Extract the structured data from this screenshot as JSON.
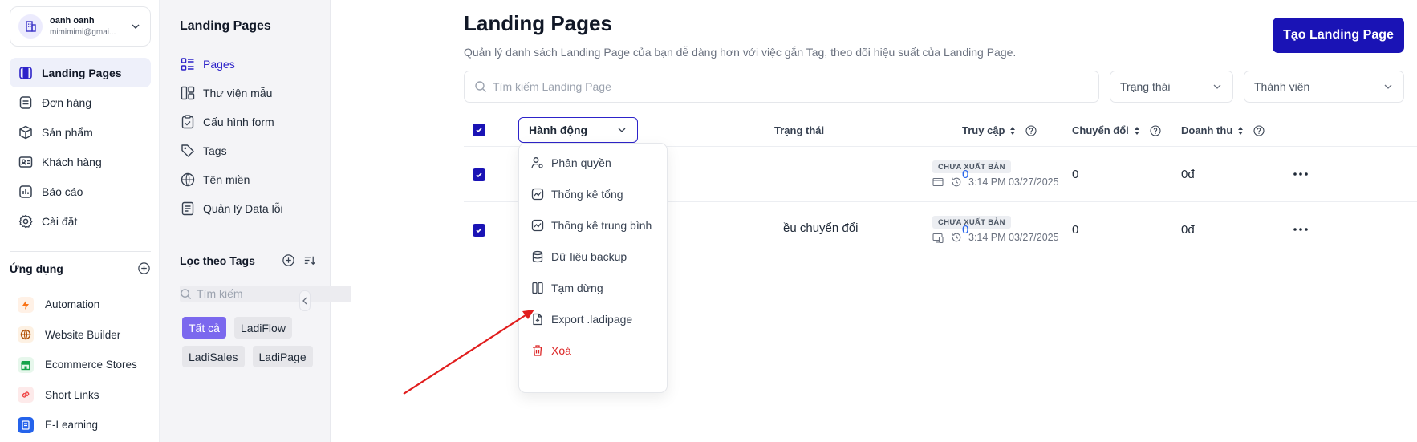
{
  "account": {
    "name": "oanh oanh",
    "email": "mimimimi@gmai..."
  },
  "nav": [
    {
      "label": "Landing Pages",
      "icon": "landing-pages-icon",
      "active": true
    },
    {
      "label": "Đơn hàng",
      "icon": "order-icon"
    },
    {
      "label": "Sản phẩm",
      "icon": "product-icon"
    },
    {
      "label": "Khách hàng",
      "icon": "customer-icon"
    },
    {
      "label": "Báo cáo",
      "icon": "report-icon"
    },
    {
      "label": "Cài đặt",
      "icon": "settings-icon"
    }
  ],
  "apps_section": {
    "title": "Ứng dụng"
  },
  "apps": [
    {
      "label": "Automation",
      "icon": "lightning-icon",
      "color": "#f97316"
    },
    {
      "label": "Website Builder",
      "icon": "globe-icon",
      "color": "#b45309"
    },
    {
      "label": "Ecommerce Stores",
      "icon": "store-icon",
      "color": "#16a34a"
    },
    {
      "label": "Short Links",
      "icon": "link-icon",
      "color": "#ef4444"
    },
    {
      "label": "E-Learning",
      "icon": "book-icon",
      "color": "#2563eb"
    }
  ],
  "subnav": {
    "title": "Landing Pages",
    "items": [
      {
        "label": "Pages",
        "icon": "pages-list-icon",
        "active": true
      },
      {
        "label": "Thư viện mẫu",
        "icon": "template-library-icon"
      },
      {
        "label": "Cấu hình form",
        "icon": "form-config-icon"
      },
      {
        "label": "Tags",
        "icon": "tag-icon"
      },
      {
        "label": "Tên miền",
        "icon": "domain-icon"
      },
      {
        "label": "Quản lý Data lỗi",
        "icon": "error-data-icon"
      }
    ],
    "tags_title": "Lọc theo Tags",
    "tags_search_placeholder": "Tìm kiếm",
    "tags": [
      {
        "label": "Tất cả",
        "active": true
      },
      {
        "label": "LadiFlow"
      },
      {
        "label": "LadiSales"
      },
      {
        "label": "LadiPage"
      }
    ]
  },
  "main": {
    "title": "Landing Pages",
    "subtitle": "Quản lý danh sách Landing Page của bạn dễ dàng hơn với việc gắn Tag, theo dõi hiệu suất của Landing Page.",
    "create_button": "Tạo Landing Page",
    "search_placeholder": "Tìm kiếm Landing Page",
    "filter_status": "Trạng thái",
    "filter_member": "Thành viên",
    "table": {
      "action_select": "Hành động",
      "columns": {
        "status": "Trạng thái",
        "visits": "Truy cập",
        "conversions": "Chuyển đổi",
        "revenue": "Doanh thu"
      },
      "rows": [
        {
          "name": "",
          "badge": "CHƯA XUẤT BẢN",
          "time": "3:14 PM 03/27/2025",
          "visits": "0",
          "conversions": "0",
          "revenue": "0đ"
        },
        {
          "name": "ều chuyển đổi",
          "badge": "CHƯA XUẤT BẢN",
          "time": "3:14 PM 03/27/2025",
          "visits": "0",
          "conversions": "0",
          "revenue": "0đ"
        }
      ]
    },
    "action_menu": [
      {
        "label": "Phân quyền",
        "icon": "user-permission-icon"
      },
      {
        "label": "Thống kê tổng",
        "icon": "stats-total-icon"
      },
      {
        "label": "Thống kê trung bình",
        "icon": "stats-average-icon"
      },
      {
        "label": "Dữ liệu backup",
        "icon": "database-icon"
      },
      {
        "label": "Tạm dừng",
        "icon": "pause-icon"
      },
      {
        "label": "Export .ladipage",
        "icon": "export-file-icon"
      },
      {
        "label": "Xoá",
        "icon": "trash-icon",
        "danger": true
      }
    ]
  },
  "colors": {
    "primary": "#1a13b5",
    "accent": "#2d23c9",
    "tag_active": "#7b68ee",
    "danger": "#dc2626",
    "link": "#2563eb",
    "arrow": "#e11d1d"
  }
}
